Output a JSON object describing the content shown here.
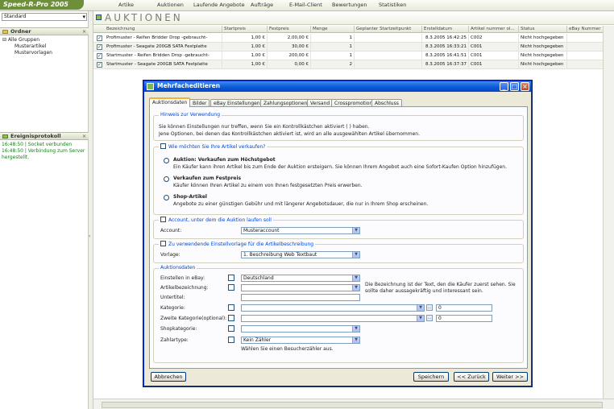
{
  "app": {
    "logo": "Speed-R-Pro 2005",
    "nav": [
      "Artike",
      "Auktionen",
      "Laufende Angebote",
      "Aufträge",
      "E-Mail-Client",
      "Bewertungen",
      "Statistiken"
    ]
  },
  "sidebar": {
    "view_select": "Standard",
    "folders_title": "Ordner",
    "tree": [
      "Alle Gruppen",
      "Musterartikel",
      "Mustervorlagen"
    ],
    "log_title": "Ereignisprotokoll",
    "log_lines": [
      "16:48:50 | Socket verbunden",
      "16:48:50 | Verbindung zum Server",
      "hergestellt."
    ],
    "splitter_glyph": "‹"
  },
  "main": {
    "title": "AUKTIONEN",
    "columns": [
      "Bezeichnung",
      "Startpreis",
      "Festpreis",
      "Menge",
      "Geplanter Startzeitpunkt",
      "Erstelldatum",
      "Artikel nummer ol...",
      "Status",
      "eBay Nummer"
    ],
    "rows": [
      {
        "checked": "✓",
        "name": "Profimuster - Reifen Bridder Drop -gebraucht-",
        "start": "1,00 €",
        "fixed": "2,00,00 €",
        "qty": "1",
        "planned": "",
        "created": "8.3.2005 16:42:25",
        "artnr": "C002",
        "status": "Nicht hochgegeben",
        "ebay": ""
      },
      {
        "checked": "✓",
        "name": "Profimuster - Seagate 200GB SATA Festplatte",
        "start": "1,00 €",
        "fixed": "30,00 €",
        "qty": "1",
        "planned": "",
        "created": "8.3.2005 16:33:21",
        "artnr": "C001",
        "status": "Nicht hochgegeben",
        "ebay": ""
      },
      {
        "checked": "✓",
        "name": "Startmuster - Reifen Bridden Drop -gebraucht-",
        "start": "1,00 €",
        "fixed": "200,00 €",
        "qty": "1",
        "planned": "",
        "created": "8.3.2005 16:41:51",
        "artnr": "C001",
        "status": "Nicht hochgegeben",
        "ebay": ""
      },
      {
        "checked": "✓",
        "name": "Startmuster - Seagate 200GB SATA Festplatte",
        "start": "1,00 €",
        "fixed": "0,00 €",
        "qty": "2",
        "planned": "",
        "created": "8.3.2005 16:37:37",
        "artnr": "C001",
        "status": "Nicht hochgegeben",
        "ebay": ""
      }
    ]
  },
  "dialog": {
    "title": "Mehrfacheditieren",
    "window_buttons": {
      "minimize": "_",
      "maximize": "□",
      "close": "×"
    },
    "tabs": [
      "Auktionsdaten",
      "Bilder",
      "eBay Einstellungen",
      "Zahlungsoptionen",
      "Versand",
      "Crosspromotion",
      "Abschluss"
    ],
    "hint": {
      "label": "Hinweis zur Verwendung",
      "line1": "Sie können Einstellungen nur treffen, wenn Sie ein Kontrollkästchen aktiviert (   ) haben.",
      "line2": "Jene Optionen, bei denen das Kontrollkästchen aktiviert ist, wird an alle ausgewählten Artikel übernommen."
    },
    "sale_type": {
      "label": "Wie möchten Sie Ihre Artikel verkaufen?",
      "options": [
        {
          "title": "Auktion: Verkaufen zum Höchstgebot",
          "desc": "Ein Käufer kann ihren Artikel bis zum Ende der Auktion ersteigern. Sie können Ihrem Angebot auch eine Sofort-Kaufen Option hinzufügen."
        },
        {
          "title": "Verkaufen zum Festpreis",
          "desc": "Käufer können Ihren Artikel zu einem von Ihnen festgesetzten Preis erwerben."
        },
        {
          "title": "Shop-Artikel",
          "desc": "Angebote zu einer günstigen Gebühr und mit längerer Angebotsdauer, die nur in Ihrem Shop erscheinen."
        }
      ]
    },
    "account": {
      "label": "Account, unter dem die Auktion laufen soll",
      "field_label": "Account:",
      "value": "Musteraccount"
    },
    "template": {
      "label": "Zu verwendende Einstellvorlage für die Artikelbeschreibung",
      "field_label": "Vorlage:",
      "value": "1. Beschreibung Web Textbaut"
    },
    "auction_data": {
      "label": "Auktionsdaten",
      "fields": [
        {
          "label": "Einstellen in eBay:",
          "value": "Deutschland"
        },
        {
          "label": "Artikelbezeichnung:",
          "value": ""
        },
        {
          "label": "Untertitel:",
          "value": ""
        },
        {
          "label": "Kategorie:",
          "value": "",
          "code": "0"
        },
        {
          "label": "Zweite Kategorie(optional):",
          "value": "",
          "code": "0"
        },
        {
          "label": "Shopkategorie:",
          "value": ""
        },
        {
          "label": "Zahlartype:",
          "value": "Kein Zähler"
        }
      ],
      "side_note": "Die Bezeichnung ist der Text, den die Käufer zuerst sehen. Sie sollte daher aussagekräftig und interessant sein.",
      "counter_note": "Wählen Sie einen Besucherzähler aus."
    },
    "buttons": {
      "cancel": "Abbrechen",
      "save": "Speichern",
      "back": "<< Zurück",
      "next": "Weiter >>"
    },
    "mini_button": "..."
  }
}
